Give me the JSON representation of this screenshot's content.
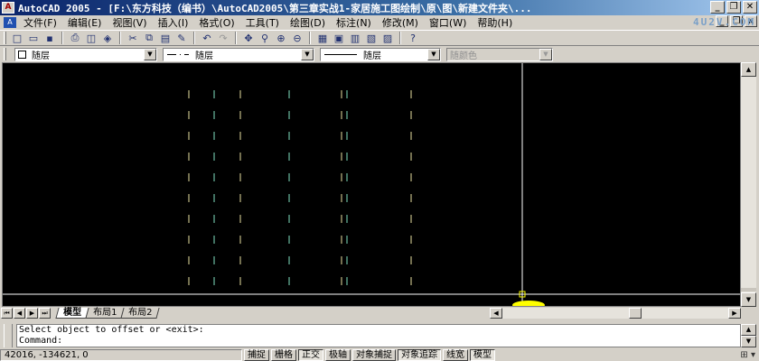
{
  "window": {
    "title": "AutoCAD 2005 - [F:\\东方科技（编书）\\AutoCAD2005\\第三章实战1-家居施工图绘制\\原\\图\\新建文件夹\\...",
    "minimize": "_",
    "restore": "❐",
    "close": "✕"
  },
  "watermark": "4U2V.COM",
  "menu": {
    "items": [
      "文件(F)",
      "编辑(E)",
      "视图(V)",
      "插入(I)",
      "格式(O)",
      "工具(T)",
      "绘图(D)",
      "标注(N)",
      "修改(M)",
      "窗口(W)",
      "帮助(H)"
    ],
    "doc_controls": [
      "_",
      "❐",
      "x"
    ]
  },
  "toolbar": {
    "icons": [
      "new-icon",
      "open-icon",
      "save-icon",
      "print-icon",
      "preview-icon",
      "publish-icon",
      "cut-icon",
      "copy-icon",
      "paste-icon",
      "matchprop-icon",
      "undo-icon",
      "redo-icon",
      "pan-icon",
      "zoom-realtime-icon",
      "zoom-window-icon",
      "zoom-previous-icon",
      "properties-icon",
      "designcenter-icon",
      "toolpalettes-icon",
      "dbconnect-icon",
      "markup-icon",
      "help-icon"
    ]
  },
  "properties_bar": {
    "layer": "随层",
    "linetype": "随层",
    "lineweight": "随层",
    "color": "随颜色"
  },
  "drawing": {
    "background": "#000000",
    "line_color": "#7fe0c0",
    "crosshair_color": "#ffffff",
    "line_count": 9
  },
  "tabs": {
    "items": [
      "模型",
      "布局1",
      "布局2"
    ],
    "active": "模型"
  },
  "command": {
    "line1": "Select object to offset or <exit>:",
    "line2": "Command:"
  },
  "status": {
    "coords": "42016, -134621, 0",
    "toggles": [
      {
        "label": "捕捉",
        "on": false
      },
      {
        "label": "栅格",
        "on": false
      },
      {
        "label": "正交",
        "on": true
      },
      {
        "label": "极轴",
        "on": false
      },
      {
        "label": "对象捕捉",
        "on": false
      },
      {
        "label": "对象追踪",
        "on": true
      },
      {
        "label": "线宽",
        "on": false
      },
      {
        "label": "模型",
        "on": true
      }
    ]
  }
}
